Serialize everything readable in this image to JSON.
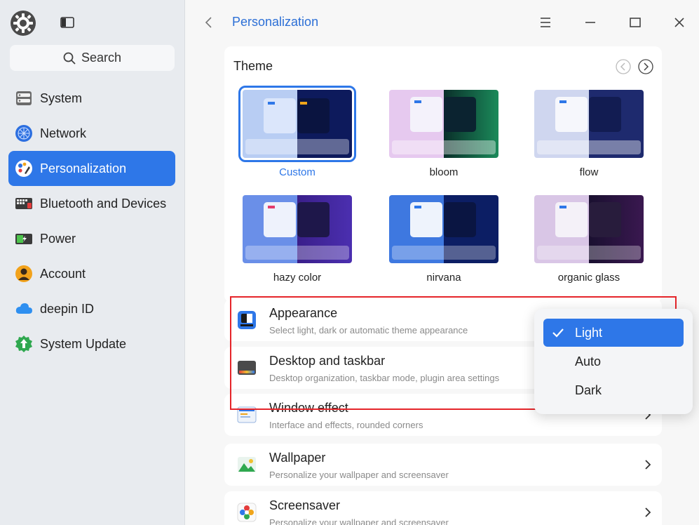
{
  "sidebar": {
    "search_label": "Search",
    "items": [
      {
        "label": "System",
        "icon": "system-icon"
      },
      {
        "label": "Network",
        "icon": "network-icon"
      },
      {
        "label": "Personalization",
        "icon": "personalization-icon"
      },
      {
        "label": "Bluetooth and Devices",
        "icon": "bluetooth-devices-icon"
      },
      {
        "label": "Power",
        "icon": "power-icon"
      },
      {
        "label": "Account",
        "icon": "account-icon"
      },
      {
        "label": "deepin ID",
        "icon": "cloud-icon"
      },
      {
        "label": "System Update",
        "icon": "update-icon"
      }
    ],
    "active_index": 2
  },
  "header": {
    "breadcrumb": "Personalization"
  },
  "theme": {
    "title": "Theme",
    "items": [
      {
        "name": "Custom",
        "selected": true
      },
      {
        "name": "bloom"
      },
      {
        "name": "flow"
      },
      {
        "name": "hazy color"
      },
      {
        "name": "nirvana"
      },
      {
        "name": "organic glass"
      }
    ]
  },
  "settings": [
    {
      "title": "Appearance",
      "desc": "Select light, dark or automatic theme appearance"
    },
    {
      "title": "Desktop and taskbar",
      "desc": "Desktop organization, taskbar mode, plugin area settings"
    },
    {
      "title": "Window effect",
      "desc": "Interface and effects, rounded corners"
    },
    {
      "title": "Wallpaper",
      "desc": "Personalize your wallpaper and screensaver"
    },
    {
      "title": "Screensaver",
      "desc": "Personalize your wallpaper and screensaver"
    }
  ],
  "appearance_dropdown": {
    "options": [
      "Light",
      "Auto",
      "Dark"
    ],
    "selected": "Light"
  },
  "colors": {
    "accent": "#2e77e8",
    "highlight": "#e5252a"
  }
}
